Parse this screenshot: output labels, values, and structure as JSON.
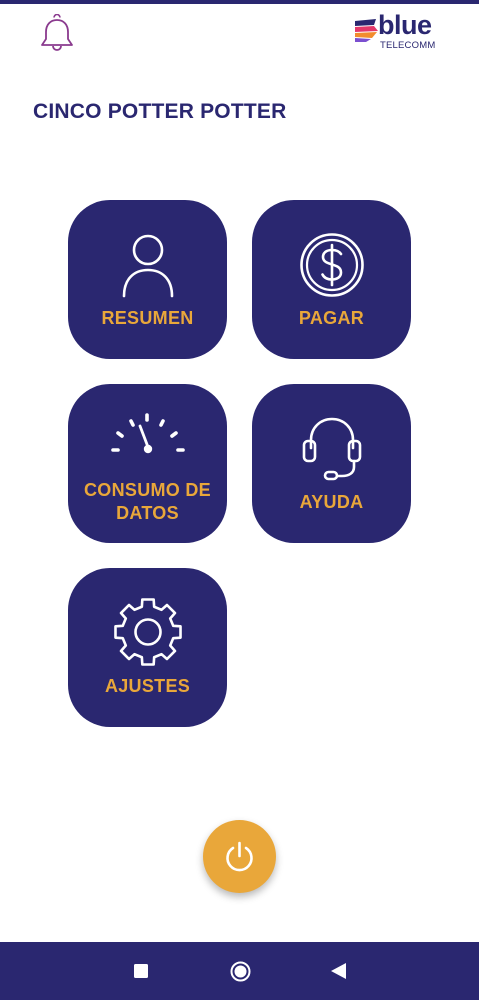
{
  "header": {
    "notification_icon": "bell-icon",
    "brand": {
      "name": "blue",
      "subtitle": "TELECOMM"
    }
  },
  "user": {
    "name": "CINCO POTTER POTTER"
  },
  "menu": {
    "tiles": [
      {
        "label": "RESUMEN",
        "icon": "user-icon"
      },
      {
        "label": "PAGAR",
        "icon": "dollar-icon"
      },
      {
        "label": "CONSUMO DE DATOS",
        "icon": "speedometer-icon"
      },
      {
        "label": "AYUDA",
        "icon": "headset-icon"
      },
      {
        "label": "AJUSTES",
        "icon": "gear-icon"
      }
    ]
  },
  "power_button": {
    "icon": "power-icon"
  },
  "system_nav": {
    "buttons": [
      "recent-apps-icon",
      "home-icon",
      "back-icon"
    ]
  },
  "colors": {
    "primary": "#2a2770",
    "accent": "#e9a73a",
    "bell": "#8a3a8e",
    "background": "#ffffff"
  }
}
